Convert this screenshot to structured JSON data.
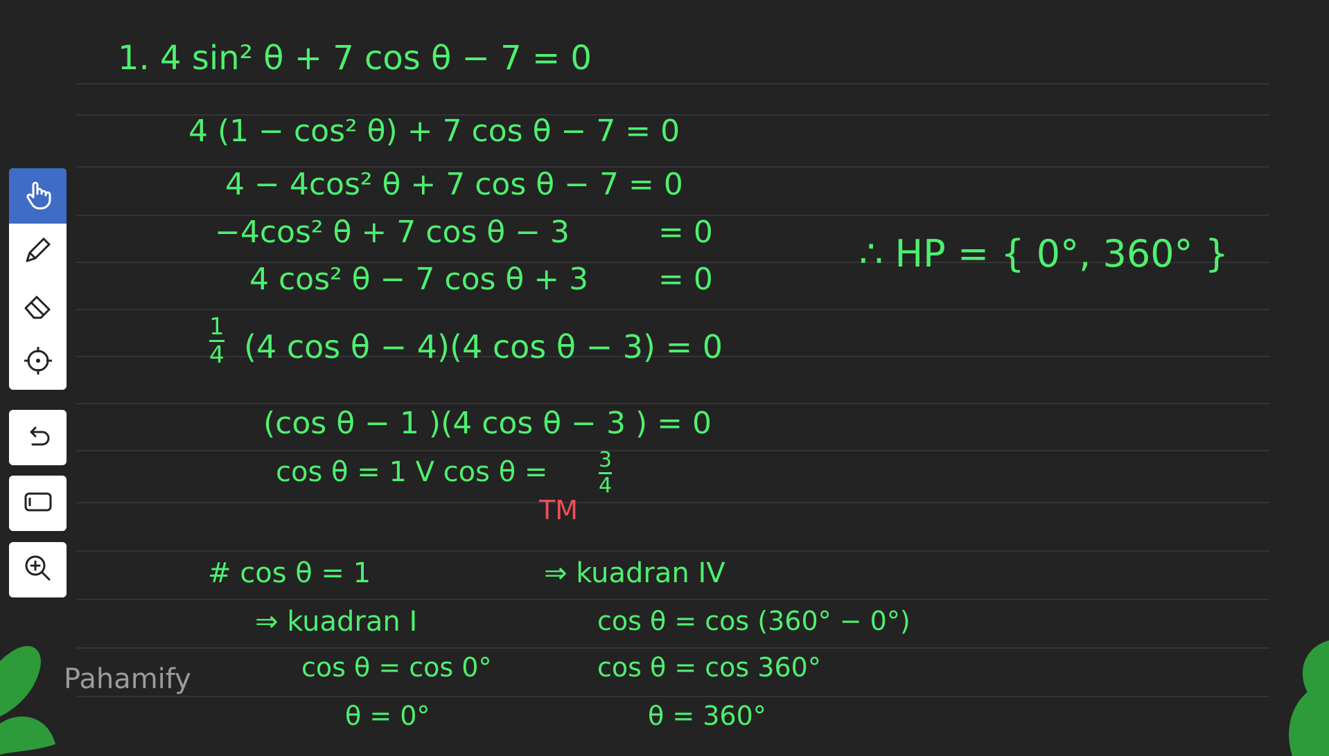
{
  "toolbar": {
    "tools": [
      {
        "name": "hand-icon",
        "active": true
      },
      {
        "name": "pen-icon"
      },
      {
        "name": "eraser-icon"
      },
      {
        "name": "crosshair-icon"
      },
      {
        "name": "undo-icon"
      },
      {
        "name": "page-icon"
      },
      {
        "name": "zoom-in-icon"
      }
    ]
  },
  "whiteboard": {
    "ink_color": "#4ef06f",
    "accent_ink_color": "#ef4f5a",
    "lines": {
      "l1": "1.  4 sin² θ + 7 cos θ − 7 = 0",
      "l2": "4 (1 − cos² θ) + 7 cos θ − 7  = 0",
      "l3": "4 − 4cos² θ + 7 cos θ − 7  = 0",
      "l4": "−4cos² θ + 7 cos θ − 3",
      "l4_rhs": "= 0",
      "l5": "4 cos² θ − 7 cos θ + 3",
      "l5_rhs": "= 0",
      "l6_frac_num": "1",
      "l6_frac_den": "4",
      "l6": "(4 cos θ − 4)(4 cos θ − 3)  = 0",
      "l7": "(cos θ − 1 )(4 cos θ − 3 )    = 0",
      "l8": "cos θ = 1   V  cos θ =",
      "l8_frac_num": "3",
      "l8_frac_den": "4",
      "tm": "TM",
      "hp": "∴ HP = { 0°, 360° }",
      "case_head": "# cos θ = 1",
      "q1_label": "⇒ kuadran I",
      "q1_eq1": "cos θ = cos 0°",
      "q1_eq2": "θ = 0°",
      "q4_label": "⇒ kuadran IV",
      "q4_eq1": "cos θ = cos (360° − 0°)",
      "q4_eq2": "cos θ = cos 360°",
      "q4_eq3": "θ = 360°"
    }
  },
  "watermark": {
    "text": "Pahamify"
  }
}
